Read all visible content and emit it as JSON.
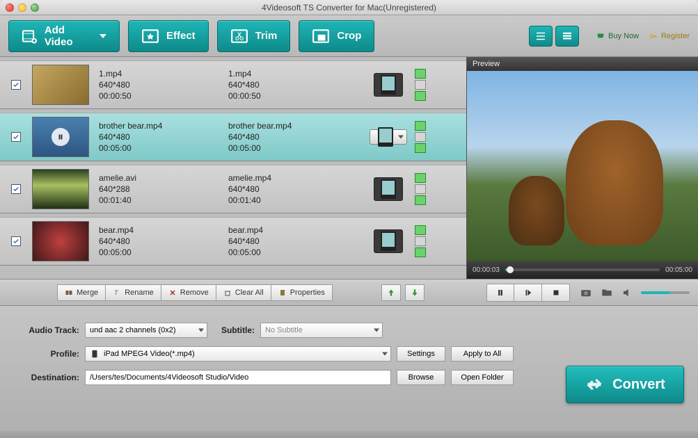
{
  "window": {
    "title": "4Videosoft TS Converter for Mac(Unregistered)"
  },
  "toolbar": {
    "add_video": "Add Video",
    "effect": "Effect",
    "trim": "Trim",
    "crop": "Crop",
    "buy_now": "Buy Now",
    "register": "Register"
  },
  "rows": [
    {
      "checked": true,
      "src_name": "1.mp4",
      "src_res": "640*480",
      "src_dur": "00:00:50",
      "out_name": "1.mp4",
      "out_res": "640*480",
      "out_dur": "00:00:50",
      "selected": false,
      "thumb": "fox"
    },
    {
      "checked": true,
      "src_name": "brother bear.mp4",
      "src_res": "640*480",
      "src_dur": "00:05:00",
      "out_name": "brother bear.mp4",
      "out_res": "640*480",
      "out_dur": "00:05:00",
      "selected": true,
      "thumb": "bear"
    },
    {
      "checked": true,
      "src_name": "amelie.avi",
      "src_res": "640*288",
      "src_dur": "00:01:40",
      "out_name": "amelie.mp4",
      "out_res": "640*480",
      "out_dur": "00:01:40",
      "selected": false,
      "thumb": "amelie"
    },
    {
      "checked": true,
      "src_name": "bear.mp4",
      "src_res": "640*480",
      "src_dur": "00:05:00",
      "out_name": "bear.mp4",
      "out_res": "640*480",
      "out_dur": "00:05:00",
      "selected": false,
      "thumb": "bear2"
    }
  ],
  "midbar": {
    "merge": "Merge",
    "rename": "Rename",
    "remove": "Remove",
    "clear_all": "Clear All",
    "properties": "Properties"
  },
  "preview": {
    "label": "Preview",
    "current_time": "00:00:03",
    "total_time": "00:05:00"
  },
  "form": {
    "audio_track_lbl": "Audio Track:",
    "audio_track_val": "und aac 2 channels (0x2)",
    "subtitle_lbl": "Subtitle:",
    "subtitle_val": "No Subtitle",
    "profile_lbl": "Profile:",
    "profile_val": "iPad MPEG4 Video(*.mp4)",
    "destination_lbl": "Destination:",
    "destination_val": "/Users/tes/Documents/4Videosoft Studio/Video",
    "settings": "Settings",
    "apply_all": "Apply to All",
    "browse": "Browse",
    "open_folder": "Open Folder",
    "convert": "Convert"
  }
}
